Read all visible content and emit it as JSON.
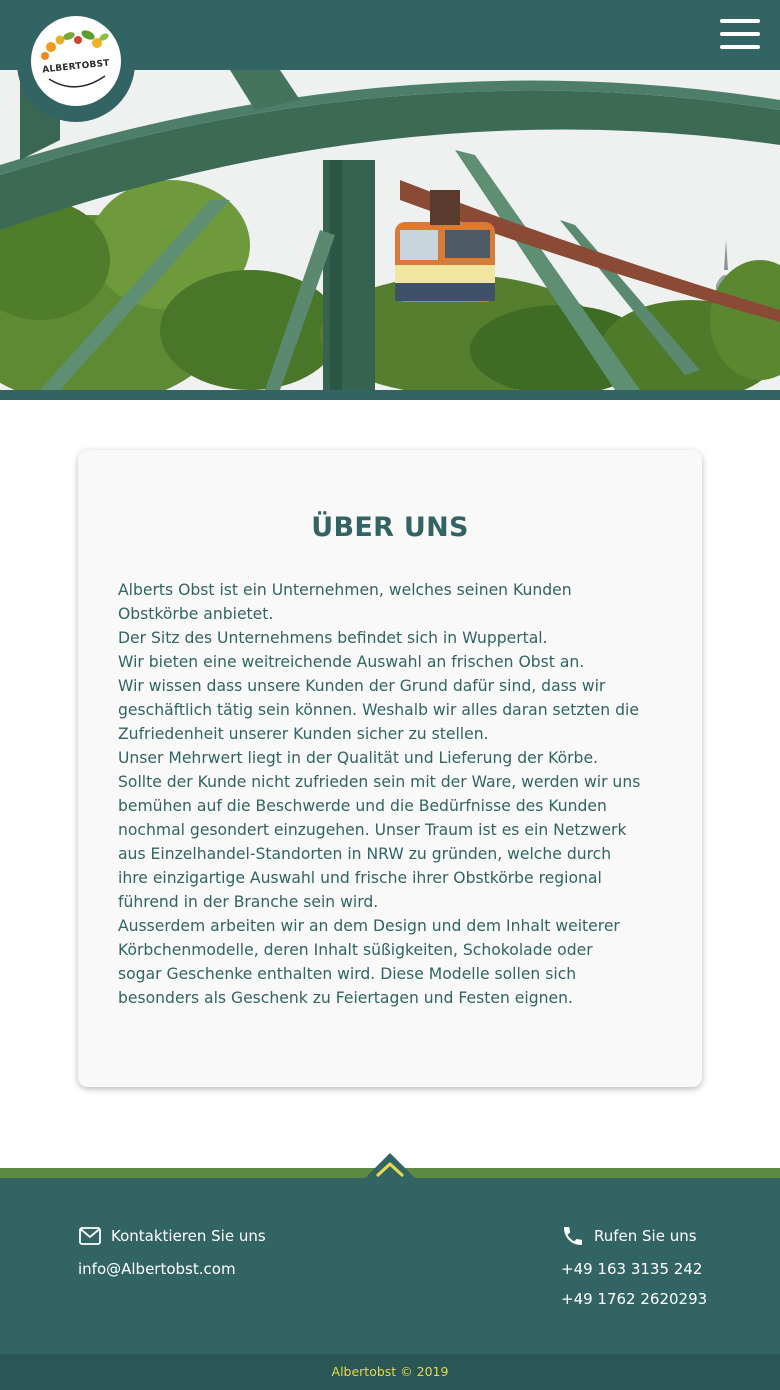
{
  "header": {
    "logo_text": "ALBERTOBST",
    "menu_icon": "hamburger-menu-icon"
  },
  "hero": {
    "image_subject": "Wuppertal Schwebebahn suspension railway"
  },
  "about": {
    "title": "ÜBER UNS",
    "lines": [
      "Alberts Obst ist ein Unternehmen, welches seinen Kunden",
      "Obstkörbe anbietet.",
      "Der Sitz des Unternehmens befindet sich in Wuppertal.",
      "Wir bieten eine weitreichende Auswahl an frischen Obst an.",
      "Wir wissen dass unsere Kunden der Grund dafür sind, dass wir",
      "geschäftlich tätig sein können. Weshalb wir alles daran setzten die",
      "Zufriedenheit unserer Kunden sicher zu stellen.",
      "Unser Mehrwert liegt in der Qualität und Lieferung der Körbe.",
      "Sollte der Kunde nicht zufrieden sein mit der Ware, werden wir uns",
      "bemühen auf die Beschwerde und die Bedürfnisse des Kunden",
      "nochmal gesondert einzugehen. Unser Traum ist es ein Netzwerk",
      "aus Einzelhandel-Standorten in NRW zu gründen, welche durch",
      "ihre einzigartige Auswahl und frische ihrer Obstkörbe regional",
      "führend in der Branche sein wird.",
      "Ausserdem arbeiten wir an dem Design und dem Inhalt weiterer",
      "Körbchenmodelle, deren Inhalt süßigkeiten, Schokolade oder",
      "sogar Geschenke enthalten wird. Diese Modelle sollen sich",
      "besonders als Geschenk zu Feiertagen und Festen eignen."
    ]
  },
  "footer": {
    "email_heading": "Kontaktieren Sie uns",
    "email": "info@Albertobst.com",
    "phone_heading": "Rufen Sie uns",
    "phones": [
      "+49 163 3135 242",
      "+49 1762 2620293"
    ],
    "copyright": "Albertobst © 2019"
  },
  "colors": {
    "primary": "#316462",
    "accent_green": "#5d8a43",
    "copyright_yellow": "#e7d94a",
    "card_bg": "#f9f9f9"
  }
}
